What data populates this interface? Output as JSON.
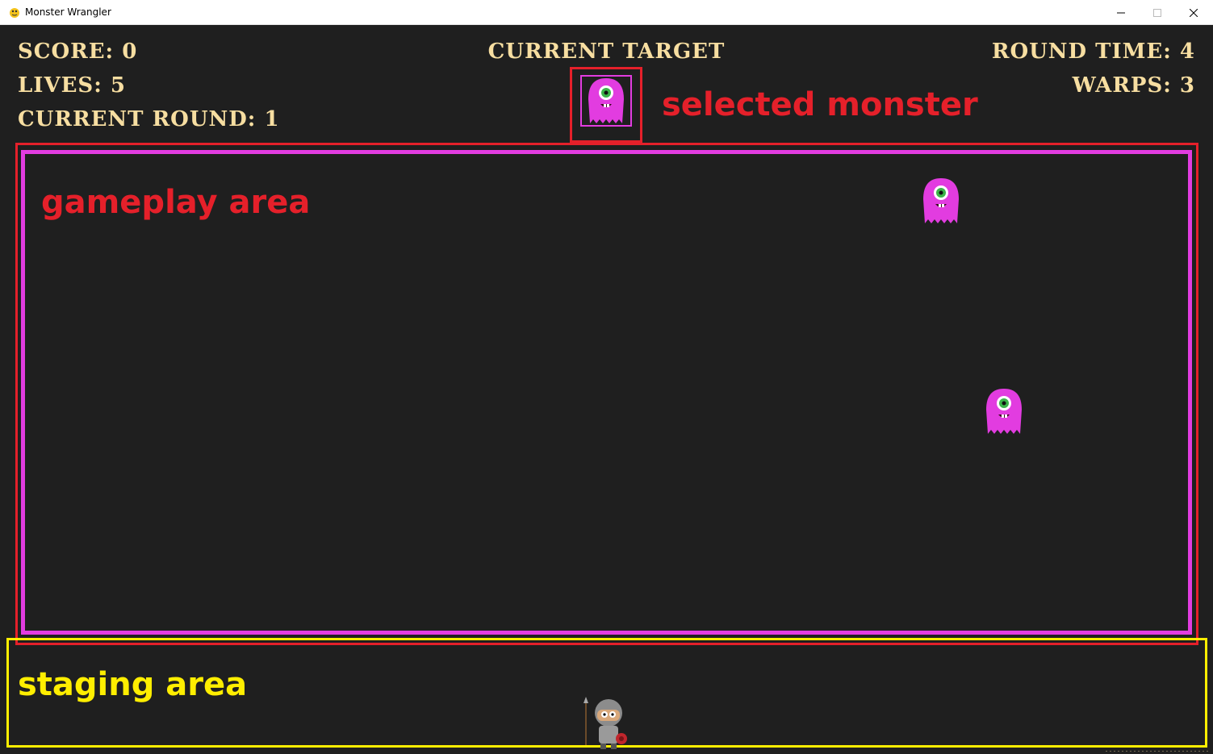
{
  "window": {
    "title": "Monster Wrangler",
    "icon": "pygame-snake-icon",
    "controls": {
      "minimize_icon": "minimize-icon",
      "maximize_icon": "maximize-icon",
      "close_icon": "close-icon"
    }
  },
  "hud": {
    "score": "Score: 0",
    "lives": "Lives: 5",
    "current_round": "Current Round: 1",
    "current_target": "Current Target",
    "round_time": "Round Time: 4",
    "warps": "Warps: 3"
  },
  "annotations": {
    "selected_monster": "selected monster",
    "gameplay_area": "gameplay area",
    "staging_area": "staging area"
  },
  "colors": {
    "background": "#1f1f1f",
    "hud_text": "#f7dea1",
    "annotation_red": "#e5202a",
    "annotation_yellow": "#ffee00",
    "monster_pink": "#e23ce0",
    "gameplay_border": "#e23ce0"
  },
  "sprites": {
    "target_monster": "pink-monster",
    "monsters": [
      "pink-monster",
      "pink-monster"
    ],
    "player": "knight-player"
  }
}
